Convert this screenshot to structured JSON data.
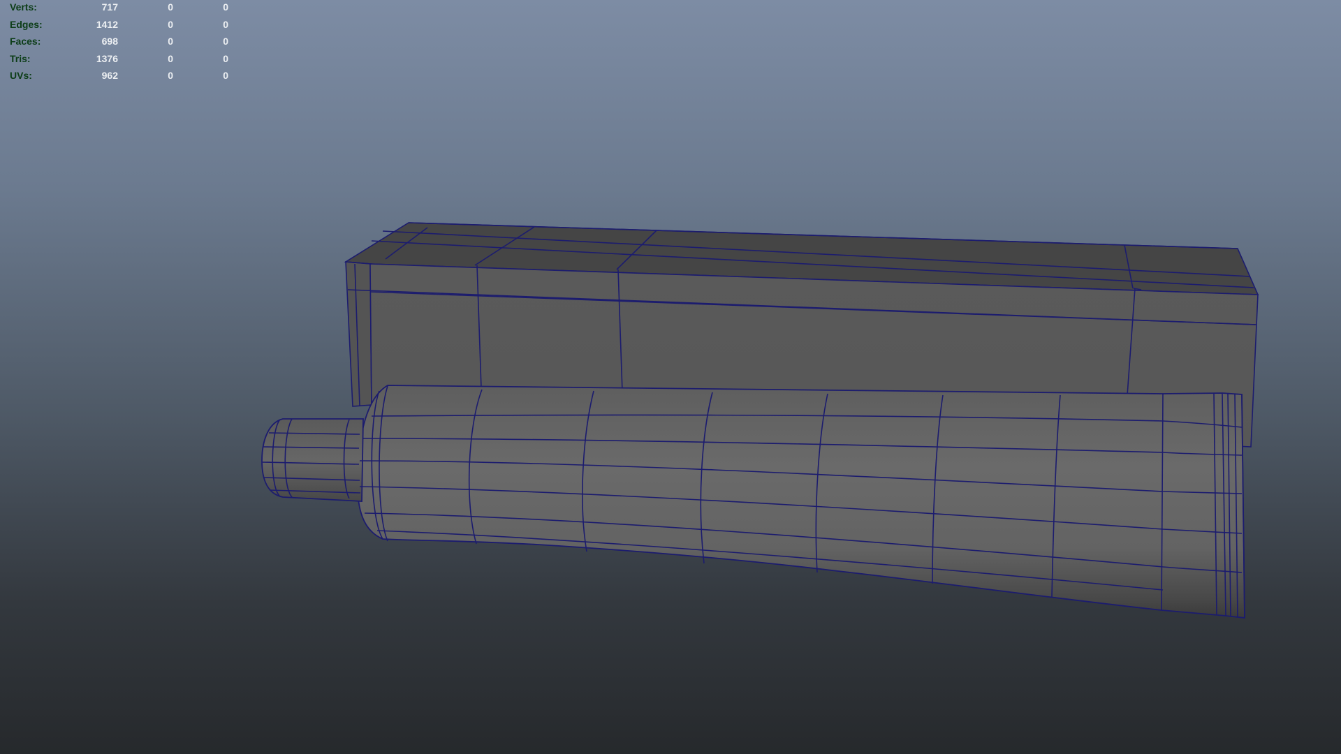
{
  "hud": {
    "rows": [
      {
        "label": "Verts:",
        "total": "717",
        "selected": "0",
        "other": "0"
      },
      {
        "label": "Edges:",
        "total": "1412",
        "selected": "0",
        "other": "0"
      },
      {
        "label": "Faces:",
        "total": "698",
        "selected": "0",
        "other": "0"
      },
      {
        "label": "Tris:",
        "total": "1376",
        "selected": "0",
        "other": "0"
      },
      {
        "label": "UVs:",
        "total": "962",
        "selected": "0",
        "other": "0"
      }
    ]
  },
  "colors": {
    "wireframe": "#1c1c6e",
    "label_text": "#0c3d17",
    "value_text": "#eceff2"
  }
}
